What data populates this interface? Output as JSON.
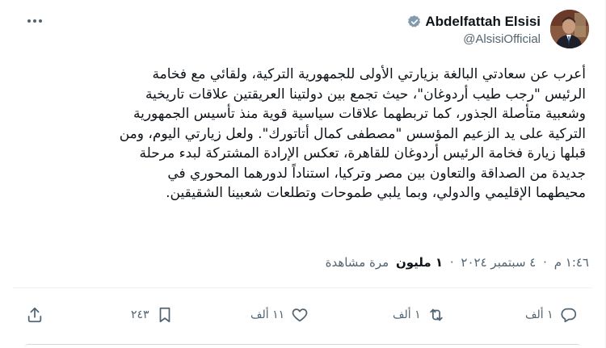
{
  "user": {
    "display_name": "Abdelfattah Elsisi",
    "handle": "@AlsisiOfficial",
    "verified": true,
    "badge_color": "#829aab"
  },
  "tweet": {
    "lines": [
      "أعرب عن سعادتي البالغة بزيارتي الأولى للجمهورية التركية، ولقائي مع فخامة",
      "الرئيس \"رجب طيب أردوغان\"، حيث تجمع بين دولتينا العريقتين علاقات تاريخية",
      "وشعبية متأصلة الجذور، كما تربطهما علاقات سياسية قوية منذ تأسيس الجمهورية",
      "التركية على يد الزعيم المؤسس \"مصطفى كمال أتاتورك\". ولعل زيارتي اليوم، ومن",
      "قبلها زيارة فخامة الرئيس أردوغان للقاهرة، تعكس الإرادة المشتركة لبدء مرحلة",
      "جديدة من الصداقة والتعاون بين مصر وتركيا، استناداً لدورهما المحوري في",
      "محيطهما الإقليمي والدولي، وبما يلبي طموحات وتطلعات شعبينا الشقيقين."
    ]
  },
  "meta": {
    "time": "١:٤٦ م",
    "separator": "·",
    "date": "٤ سبتمبر ٢٠٢٤",
    "views_count": "١ مليون",
    "views_label": "مرة مشاهدة"
  },
  "actions": {
    "replies": "١ ألف",
    "reposts": "١ ألف",
    "likes": "١١ ألف",
    "bookmarks": "٢٤٣",
    "icon_color": "#536471"
  },
  "icons": {
    "more": "more-horizontal-icon",
    "reply": "reply-icon",
    "repost": "repost-icon",
    "like": "heart-icon",
    "bookmark": "bookmark-icon",
    "share": "share-icon",
    "verified": "verified-badge-icon"
  }
}
